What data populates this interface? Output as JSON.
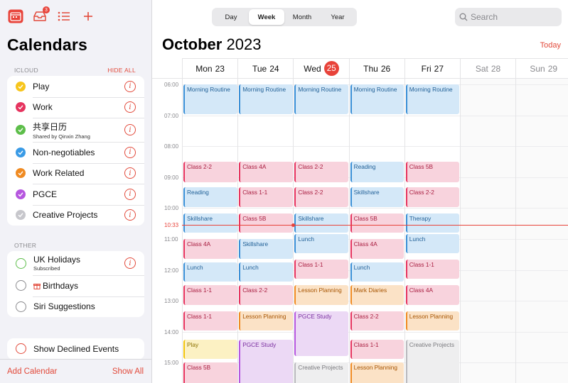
{
  "sidebar": {
    "inbox_badge": "3",
    "title": "Calendars",
    "icloud": {
      "header": "ICLOUD",
      "action": "HIDE ALL",
      "items": [
        {
          "label": "Play",
          "color": "#f7c51c"
        },
        {
          "label": "Work",
          "color": "#e6345f"
        },
        {
          "label": "共享日历",
          "sublabel": "Shared by Qinxin Zhang",
          "color": "#5dbe4a"
        },
        {
          "label": "Non-negotiables",
          "color": "#3a9be6"
        },
        {
          "label": "Work Related",
          "color": "#f08b22"
        },
        {
          "label": "PGCE",
          "color": "#b657df"
        },
        {
          "label": "Creative Projects",
          "color": "#c7c7cc"
        }
      ]
    },
    "other": {
      "header": "OTHER",
      "items": [
        {
          "label": "UK Holidays",
          "sublabel": "Subscribed",
          "ring": "#5dbe4a"
        },
        {
          "label": "Birthdays",
          "ring": "#8a8a8e"
        },
        {
          "label": "Siri Suggestions",
          "ring": "#8a8a8e"
        }
      ]
    },
    "declined": {
      "label": "Show Declined Events"
    },
    "add_calendar": "Add Calendar",
    "show_all": "Show All"
  },
  "toolbar": {
    "views": [
      "Day",
      "Week",
      "Month",
      "Year"
    ],
    "active_view": "Week",
    "search_placeholder": "Search"
  },
  "header": {
    "month": "October",
    "year": "2023",
    "today": "Today"
  },
  "days": [
    {
      "name": "Mon",
      "num": "23"
    },
    {
      "name": "Tue",
      "num": "24"
    },
    {
      "name": "Wed",
      "num": "25",
      "today": true
    },
    {
      "name": "Thu",
      "num": "26"
    },
    {
      "name": "Fri",
      "num": "27"
    },
    {
      "name": "Sat",
      "num": "28",
      "weekend": true
    },
    {
      "name": "Sun",
      "num": "29",
      "weekend": true
    }
  ],
  "hours": [
    "06:00",
    "07:00",
    "08:00",
    "09:00",
    "10:00",
    "11:00",
    "12:00",
    "13:00",
    "14:00",
    "15:00"
  ],
  "now": {
    "label": "10:33",
    "time": 10.55
  },
  "events": [
    {
      "day": 0,
      "start": 6.0,
      "end": 7.0,
      "title": "Morning Routine",
      "color": "blue"
    },
    {
      "day": 1,
      "start": 6.0,
      "end": 7.0,
      "title": "Morning Routine",
      "color": "blue"
    },
    {
      "day": 2,
      "start": 6.0,
      "end": 7.0,
      "title": "Morning Routine",
      "color": "blue"
    },
    {
      "day": 3,
      "start": 6.0,
      "end": 7.0,
      "title": "Morning Routine",
      "color": "blue"
    },
    {
      "day": 4,
      "start": 6.0,
      "end": 7.0,
      "title": "Morning Routine",
      "color": "blue"
    },
    {
      "day": 0,
      "start": 8.5,
      "end": 9.2,
      "title": "Class 2-2",
      "color": "pink"
    },
    {
      "day": 1,
      "start": 8.5,
      "end": 9.2,
      "title": "Class 4A",
      "color": "pink"
    },
    {
      "day": 2,
      "start": 8.5,
      "end": 9.2,
      "title": "Class 2-2",
      "color": "pink"
    },
    {
      "day": 3,
      "start": 8.5,
      "end": 9.2,
      "title": "Reading",
      "color": "blue"
    },
    {
      "day": 4,
      "start": 8.5,
      "end": 9.2,
      "title": "Class 5B",
      "color": "pink"
    },
    {
      "day": 0,
      "start": 9.33,
      "end": 10.0,
      "title": "Reading",
      "color": "blue"
    },
    {
      "day": 1,
      "start": 9.33,
      "end": 10.0,
      "title": "Class 1-1",
      "color": "pink"
    },
    {
      "day": 2,
      "start": 9.33,
      "end": 10.0,
      "title": "Class 2-2",
      "color": "pink"
    },
    {
      "day": 3,
      "start": 9.33,
      "end": 10.0,
      "title": "Skillshare",
      "color": "blue"
    },
    {
      "day": 4,
      "start": 9.33,
      "end": 10.0,
      "title": "Class 2-2",
      "color": "pink"
    },
    {
      "day": 0,
      "start": 10.17,
      "end": 10.83,
      "title": "Skillshare",
      "color": "blue"
    },
    {
      "day": 1,
      "start": 10.17,
      "end": 10.83,
      "title": "Class 5B",
      "color": "pink"
    },
    {
      "day": 2,
      "start": 10.17,
      "end": 10.83,
      "title": "Skillshare",
      "color": "blue"
    },
    {
      "day": 3,
      "start": 10.17,
      "end": 10.83,
      "title": "Class 5B",
      "color": "pink"
    },
    {
      "day": 4,
      "start": 10.17,
      "end": 10.83,
      "title": "Therapy",
      "color": "blue"
    },
    {
      "day": 0,
      "start": 11.0,
      "end": 11.67,
      "title": "Class 4A",
      "color": "pink"
    },
    {
      "day": 1,
      "start": 11.0,
      "end": 11.67,
      "title": "Skillshare",
      "color": "blue"
    },
    {
      "day": 2,
      "start": 10.83,
      "end": 11.5,
      "title": "Lunch",
      "color": "blue"
    },
    {
      "day": 3,
      "start": 11.0,
      "end": 11.67,
      "title": "Class 4A",
      "color": "pink"
    },
    {
      "day": 4,
      "start": 10.83,
      "end": 11.5,
      "title": "Lunch",
      "color": "blue"
    },
    {
      "day": 0,
      "start": 11.75,
      "end": 12.42,
      "title": "Lunch",
      "color": "blue"
    },
    {
      "day": 1,
      "start": 11.75,
      "end": 12.42,
      "title": "Lunch",
      "color": "blue"
    },
    {
      "day": 2,
      "start": 11.67,
      "end": 12.33,
      "title": "Class 1-1",
      "color": "pink"
    },
    {
      "day": 3,
      "start": 11.75,
      "end": 12.42,
      "title": "Lunch",
      "color": "blue"
    },
    {
      "day": 4,
      "start": 11.67,
      "end": 12.33,
      "title": "Class 1-1",
      "color": "pink"
    },
    {
      "day": 0,
      "start": 12.5,
      "end": 13.17,
      "title": "Class 1-1",
      "color": "pink"
    },
    {
      "day": 1,
      "start": 12.5,
      "end": 13.17,
      "title": "Class 2-2",
      "color": "pink"
    },
    {
      "day": 2,
      "start": 12.5,
      "end": 13.17,
      "title": "Lesson Planning",
      "color": "orange"
    },
    {
      "day": 3,
      "start": 12.5,
      "end": 13.17,
      "title": "Mark Diaries",
      "color": "orange"
    },
    {
      "day": 4,
      "start": 12.5,
      "end": 13.17,
      "title": "Class 4A",
      "color": "pink"
    },
    {
      "day": 0,
      "start": 13.33,
      "end": 14.0,
      "title": "Class 1-1",
      "color": "pink"
    },
    {
      "day": 1,
      "start": 13.33,
      "end": 14.0,
      "title": "Lesson Planning",
      "color": "orange"
    },
    {
      "day": 2,
      "start": 13.33,
      "end": 14.83,
      "title": "PGCE Study",
      "color": "purple"
    },
    {
      "day": 3,
      "start": 13.33,
      "end": 14.0,
      "title": "Class 2-2",
      "color": "pink"
    },
    {
      "day": 4,
      "start": 13.33,
      "end": 14.0,
      "title": "Lesson Planning",
      "color": "orange"
    },
    {
      "day": 0,
      "start": 14.25,
      "end": 14.92,
      "title": "Play",
      "color": "yellow"
    },
    {
      "day": 1,
      "start": 14.25,
      "end": 16.0,
      "title": "PGCE Study",
      "color": "purple"
    },
    {
      "day": 3,
      "start": 14.25,
      "end": 14.92,
      "title": "Class 1-1",
      "color": "pink"
    },
    {
      "day": 4,
      "start": 14.25,
      "end": 16.0,
      "title": "Creative Projects",
      "color": "gray"
    },
    {
      "day": 0,
      "start": 15.0,
      "end": 16.0,
      "title": "Class 5B",
      "color": "pink"
    },
    {
      "day": 2,
      "start": 15.0,
      "end": 16.0,
      "title": "Creative Projects",
      "color": "gray"
    },
    {
      "day": 3,
      "start": 15.0,
      "end": 16.0,
      "title": "Lesson Planning",
      "color": "orange"
    }
  ]
}
